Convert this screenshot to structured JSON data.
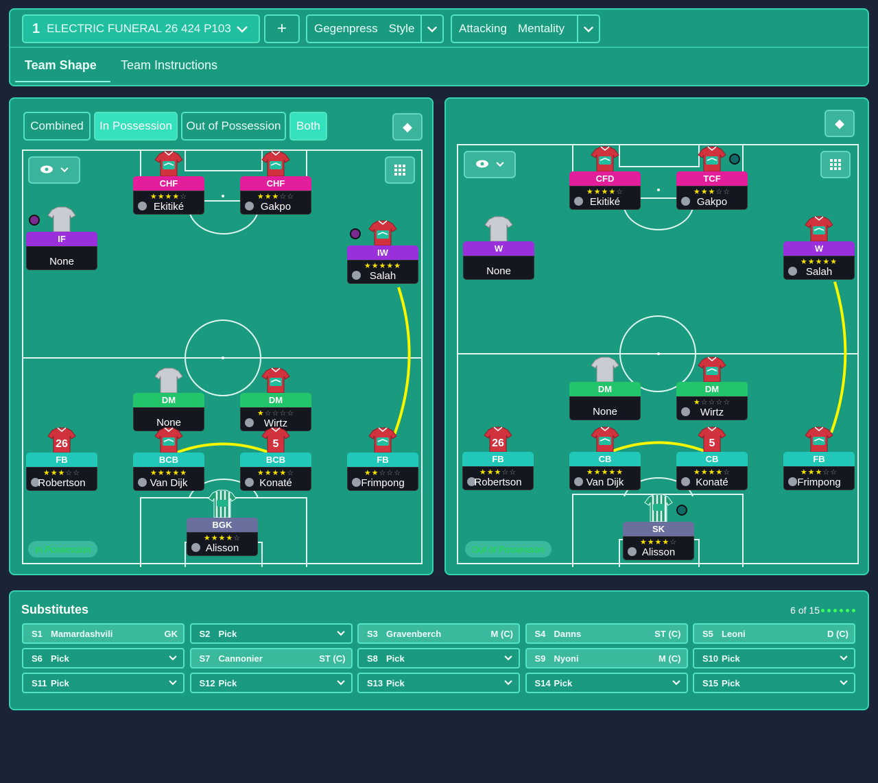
{
  "header": {
    "tactic_number": "1",
    "tactic_name": "ELECTRIC FUNERAL 26 424 P103",
    "add_label": "+",
    "style_value": "Gegenpress",
    "style_label": "Style",
    "mentality_value": "Attacking",
    "mentality_label": "Mentality"
  },
  "tabs": {
    "team_shape": "Team Shape",
    "team_instructions": "Team Instructions"
  },
  "phase_toggle": {
    "combined": "Combined",
    "in_possession": "In Possession",
    "out_of_possession": "Out of Possession",
    "both": "Both"
  },
  "left_pitch": {
    "phase_label": "In Possession",
    "players": [
      {
        "role": "CHF",
        "stars": "★★★★☆",
        "name": "Ekitiké"
      },
      {
        "role": "CHF",
        "stars": "★★★☆☆",
        "name": "Gakpo"
      },
      {
        "role": "IF",
        "stars": "",
        "name": "None"
      },
      {
        "role": "IW",
        "stars": "★★★★★",
        "name": "Salah"
      },
      {
        "role": "DM",
        "stars": "",
        "name": "None"
      },
      {
        "role": "DM",
        "stars": "★☆☆☆☆",
        "name": "Wirtz"
      },
      {
        "role": "FB",
        "stars": "★★★☆☆",
        "name": "Robertson"
      },
      {
        "role": "BCB",
        "stars": "★★★★★",
        "name": "Van Dijk"
      },
      {
        "role": "BCB",
        "stars": "★★★★☆",
        "name": "Konaté"
      },
      {
        "role": "FB",
        "stars": "★★☆☆☆",
        "name": "Frimpong"
      },
      {
        "role": "BGK",
        "stars": "★★★★☆",
        "name": "Alisson"
      }
    ]
  },
  "right_pitch": {
    "phase_label": "Out of Possession",
    "players": [
      {
        "role": "CFD",
        "stars": "★★★★☆",
        "name": "Ekitiké"
      },
      {
        "role": "TCF",
        "stars": "★★★☆☆",
        "name": "Gakpo"
      },
      {
        "role": "W",
        "stars": "",
        "name": "None"
      },
      {
        "role": "W",
        "stars": "★★★★★",
        "name": "Salah"
      },
      {
        "role": "DM",
        "stars": "",
        "name": "None"
      },
      {
        "role": "DM",
        "stars": "★☆☆☆☆",
        "name": "Wirtz"
      },
      {
        "role": "FB",
        "stars": "★★★☆☆",
        "name": "Robertson"
      },
      {
        "role": "CB",
        "stars": "★★★★★",
        "name": "Van Dijk"
      },
      {
        "role": "CB",
        "stars": "★★★★☆",
        "name": "Konaté"
      },
      {
        "role": "FB",
        "stars": "★★★☆☆",
        "name": "Frimpong"
      },
      {
        "role": "SK",
        "stars": "★★★★☆",
        "name": "Alisson"
      }
    ]
  },
  "shirt_numbers": {
    "robertson": "26",
    "konate": "5"
  },
  "substitutes": {
    "title": "Substitutes",
    "count": "6 of 15",
    "slots": [
      {
        "slot": "S1",
        "name": "Mamardashvili",
        "pos": "GK"
      },
      {
        "slot": "S2",
        "name": "Pick",
        "pos": ""
      },
      {
        "slot": "S3",
        "name": "Gravenberch",
        "pos": "M (C)"
      },
      {
        "slot": "S4",
        "name": "Danns",
        "pos": "ST (C)"
      },
      {
        "slot": "S5",
        "name": "Leoni",
        "pos": "D (C)"
      },
      {
        "slot": "S6",
        "name": "Pick",
        "pos": ""
      },
      {
        "slot": "S7",
        "name": "Cannonier",
        "pos": "ST (C)"
      },
      {
        "slot": "S8",
        "name": "Pick",
        "pos": ""
      },
      {
        "slot": "S9",
        "name": "Nyoni",
        "pos": "M (C)"
      },
      {
        "slot": "S10",
        "name": "Pick",
        "pos": ""
      },
      {
        "slot": "S11",
        "name": "Pick",
        "pos": ""
      },
      {
        "slot": "S12",
        "name": "Pick",
        "pos": ""
      },
      {
        "slot": "S13",
        "name": "Pick",
        "pos": ""
      },
      {
        "slot": "S14",
        "name": "Pick",
        "pos": ""
      },
      {
        "slot": "S15",
        "name": "Pick",
        "pos": ""
      }
    ]
  },
  "colors": {
    "panel": "#1a9b80",
    "accent": "#35e0bc",
    "link_line": "#f7f700",
    "background": "#1b2437"
  }
}
